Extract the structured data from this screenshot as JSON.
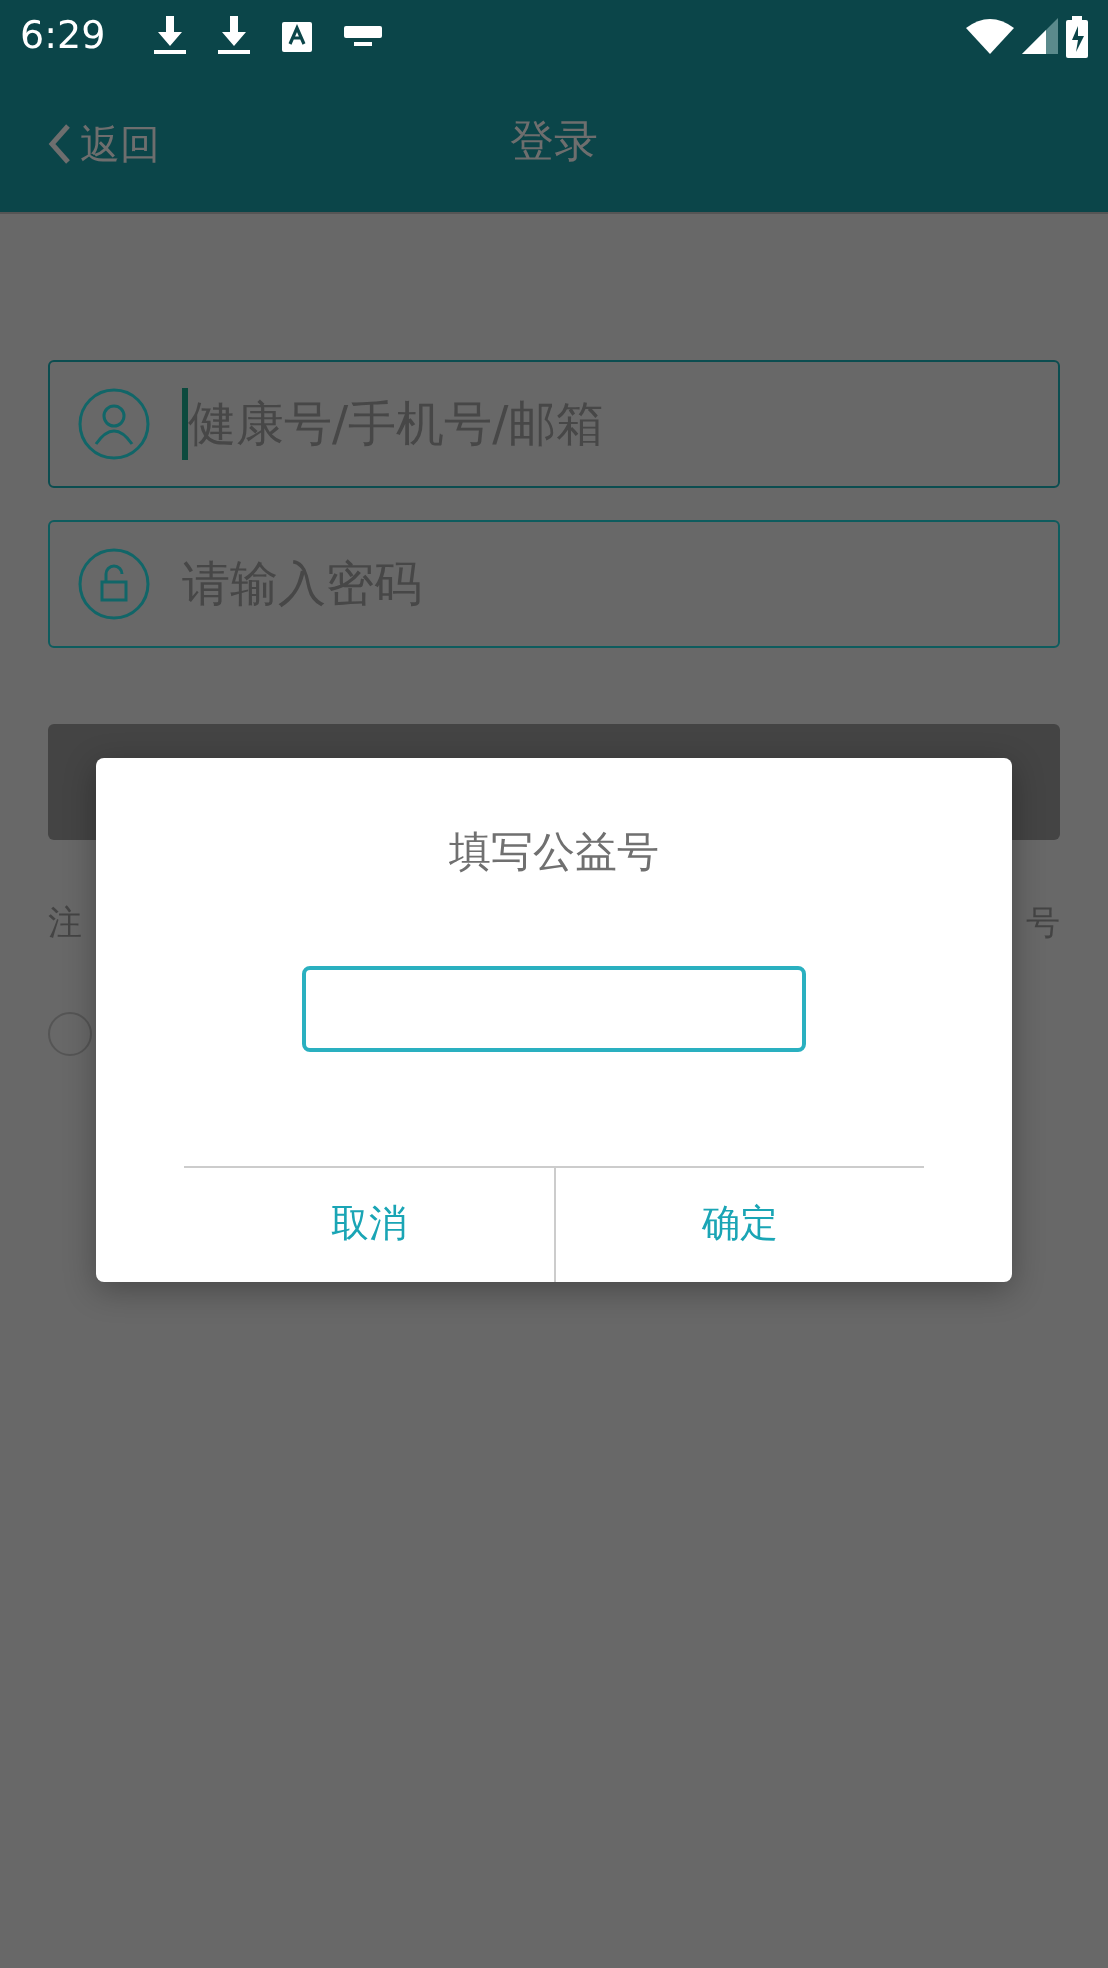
{
  "status_bar": {
    "time": "6:29"
  },
  "app_bar": {
    "back_label": "返回",
    "title": "登录"
  },
  "form": {
    "account_field": {
      "placeholder": "健康号/手机号/邮箱",
      "focused": true
    },
    "password_field": {
      "placeholder": "请输入密码"
    },
    "left_link": "注",
    "right_link": "号",
    "agree_checked": false
  },
  "dialog": {
    "title": "填写公益号",
    "buttons": [
      {
        "label": "取消"
      },
      {
        "label": "确定"
      }
    ]
  }
}
